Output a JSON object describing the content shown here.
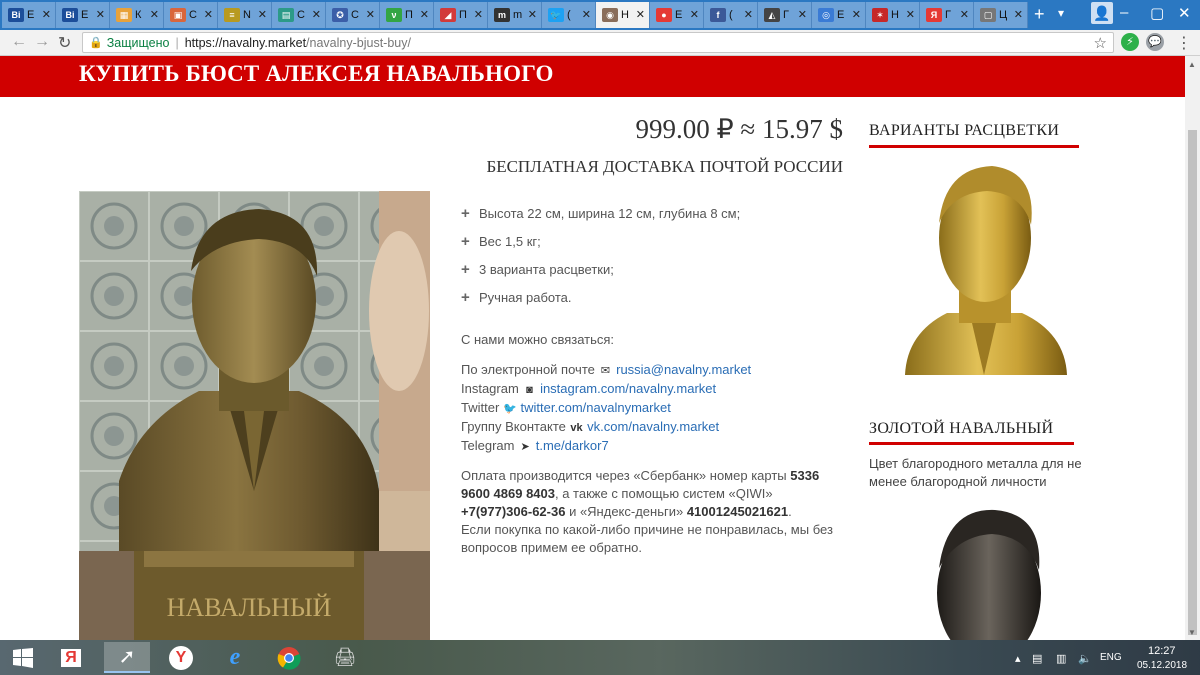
{
  "browser": {
    "tabs": [
      {
        "label": "E",
        "fav": "Bill",
        "color": "#1c4e9a"
      },
      {
        "label": "E",
        "fav": "Bill",
        "color": "#1c4e9a"
      },
      {
        "label": "К",
        "fav": "▦",
        "color": "#e8a23a"
      },
      {
        "label": "С",
        "fav": "▣",
        "color": "#d9663c"
      },
      {
        "label": "N",
        "fav": "≡",
        "color": "#b89a20"
      },
      {
        "label": "С",
        "fav": "▤",
        "color": "#2c9a88"
      },
      {
        "label": "С",
        "fav": "✪",
        "color": "#3b5ea8"
      },
      {
        "label": "П",
        "fav": "ν",
        "color": "#33a544"
      },
      {
        "label": "П",
        "fav": "◢",
        "color": "#d23a3a"
      },
      {
        "label": "m",
        "fav": "m",
        "color": "#333333"
      },
      {
        "label": "(",
        "fav": "🐦",
        "color": "#1da1f2"
      },
      {
        "label": "Н",
        "fav": "◉",
        "color": "#8a6d5a"
      },
      {
        "label": "Е",
        "fav": "●",
        "color": "#e53935"
      },
      {
        "label": "(",
        "fav": "f",
        "color": "#3b5998"
      },
      {
        "label": "Г",
        "fav": "◭",
        "color": "#444444"
      },
      {
        "label": "E",
        "fav": "◎",
        "color": "#3a7bd5"
      },
      {
        "label": "Н",
        "fav": "✶",
        "color": "#c62828"
      },
      {
        "label": "Г",
        "fav": "Я",
        "color": "#e53935"
      },
      {
        "label": "Ц",
        "fav": "▢",
        "color": "#777777"
      }
    ],
    "new_tab": "+",
    "address": {
      "secure_label": "Защищено",
      "host": "https://navalny.market",
      "path": "/navalny-bjust-buy/"
    }
  },
  "page": {
    "title": "КУПИТЬ БЮСТ АЛЕКСЕЯ НАВАЛЬНОГО",
    "price": "999.00 ₽ ≈ 15.97 $",
    "delivery": "БЕСПЛАТНАЯ ДОСТАВКА ПОЧТОЙ РОССИИ",
    "features": [
      "Высота 22 см, ширина 12 см, глубина 8 см;",
      "Вес 1,5 кг;",
      "3 варианта расцветки;",
      "Ручная работа."
    ],
    "contact": {
      "heading": "С нами можно связаться:",
      "email": {
        "label": "По электронной почте",
        "icon": "envelope-icon",
        "link": "russia@navalny.market"
      },
      "instagram": {
        "label": "Instagram",
        "icon": "instagram-icon",
        "link": "instagram.com/navalny.market"
      },
      "twitter": {
        "label": "Twitter",
        "icon": "twitter-icon",
        "link": "twitter.com/navalnymarket"
      },
      "vk": {
        "label": "Группу Вконтакте",
        "icon": "vk-icon",
        "link": "vk.com/navalny.market"
      },
      "telegram": {
        "label": "Telegram",
        "icon": "telegram-icon",
        "link": "t.me/darkor7"
      }
    },
    "payment": {
      "p1": "Оплата производится через «Сбербанк» номер карты ",
      "card": "5336 9600 4869 8403",
      "p2": ", а также с помощью систем «QIWI» ",
      "qiwi": "+7(977)306-62-36",
      "p3": " и «Яндекс-деньги» ",
      "yandex": "41001245021621",
      "p4": ".",
      "refund": "Если покупка по какой-либо причине не понравилась, мы без вопросов примем ее обратно."
    },
    "bust_inscription": "НАВАЛЬНЫЙ",
    "sidebar": {
      "variants_heading": "ВАРИАНТЫ РАСЦВЕТКИ",
      "gold_heading": "ЗОЛОТОЙ НАВАЛЬНЫЙ",
      "gold_desc": "Цвет благородного металла для не менее благородной личности"
    }
  },
  "taskbar": {
    "lang": "ENG",
    "time": "12:27",
    "date": "05.12.2018"
  },
  "colors": {
    "brand_red": "#d00000",
    "link_blue": "#2a6db5"
  }
}
